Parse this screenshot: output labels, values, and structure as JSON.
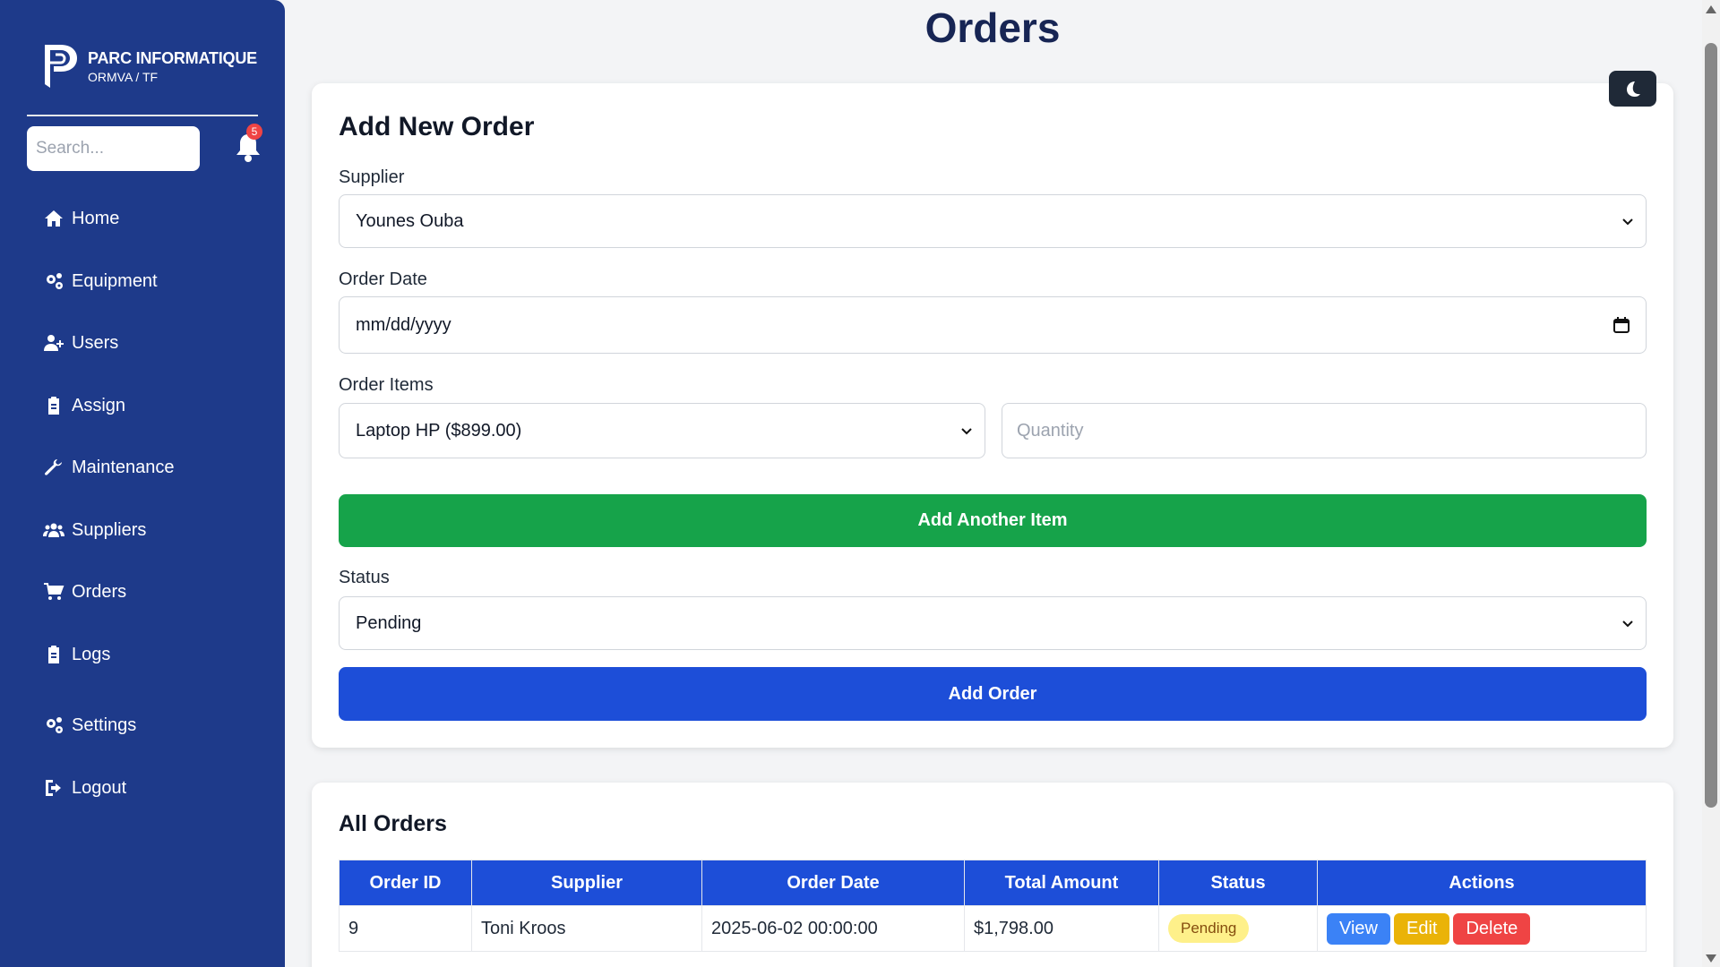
{
  "brand": {
    "title": "PARC INFORMATIQUE",
    "subtitle": "ORMVA / TF"
  },
  "search": {
    "placeholder": "Search..."
  },
  "notifications": {
    "count": "5"
  },
  "nav": [
    {
      "label": "Home",
      "icon": "home-icon"
    },
    {
      "label": "Equipment",
      "icon": "gears-icon"
    },
    {
      "label": "Users",
      "icon": "user-plus-icon"
    },
    {
      "label": "Assign",
      "icon": "clipboard-icon"
    },
    {
      "label": "Maintenance",
      "icon": "wrench-icon"
    },
    {
      "label": "Suppliers",
      "icon": "users-icon"
    },
    {
      "label": "Orders",
      "icon": "cart-icon"
    },
    {
      "label": "Logs",
      "icon": "clipboard-icon"
    },
    {
      "label": "Settings",
      "icon": "gears-icon"
    },
    {
      "label": "Logout",
      "icon": "logout-icon"
    }
  ],
  "page": {
    "title": "Orders"
  },
  "form": {
    "title": "Add New Order",
    "supplier_label": "Supplier",
    "supplier_value": "Younes Ouba",
    "date_label": "Order Date",
    "date_value": "mm/dd/yyyy",
    "items_label": "Order Items",
    "item_value": "Laptop HP ($899.00)",
    "quantity_placeholder": "Quantity",
    "add_item_label": "Add Another Item",
    "status_label": "Status",
    "status_value": "Pending",
    "submit_label": "Add Order"
  },
  "orders": {
    "title": "All Orders",
    "columns": [
      "Order ID",
      "Supplier",
      "Order Date",
      "Total Amount",
      "Status",
      "Actions"
    ],
    "rows": [
      {
        "id": "9",
        "supplier": "Toni Kroos",
        "date": "2025-06-02 00:00:00",
        "total": "$1,798.00",
        "status": "Pending"
      }
    ],
    "actions": {
      "view": "View",
      "edit": "Edit",
      "delete": "Delete"
    }
  },
  "colors": {
    "sidebar": "#1e3a8a",
    "primary": "#1d4ed8",
    "success": "#16a34a",
    "danger": "#ef4444",
    "warning": "#eab308"
  }
}
